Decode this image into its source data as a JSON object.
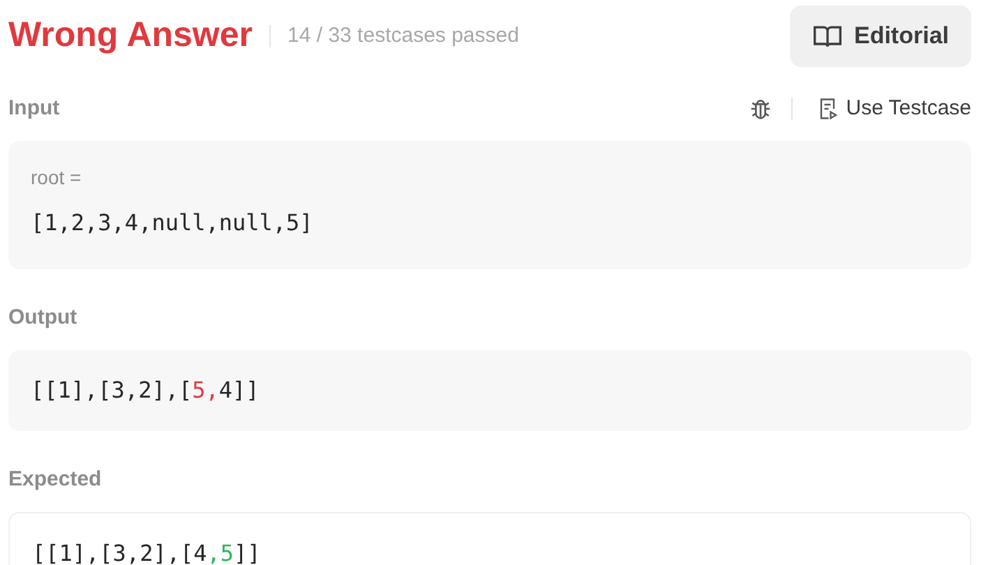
{
  "header": {
    "verdict": "Wrong Answer",
    "summary": "14 / 33 testcases passed",
    "editorial_button": "Editorial"
  },
  "sections": [
    {
      "label": "Input",
      "actions": [
        {
          "kind": "debug"
        },
        {
          "kind": "use_testcase",
          "label": "Use Testcase"
        }
      ],
      "boxed": true,
      "variable": "root =",
      "segments": [
        {
          "kind": "plain",
          "text": "[1,2,3,4,null,null,5]"
        }
      ]
    },
    {
      "label": "Output",
      "boxed": true,
      "segments": [
        {
          "kind": "plain",
          "text": "[[1],[3,2],["
        },
        {
          "kind": "wrong",
          "text": "5,"
        },
        {
          "kind": "plain",
          "text": "4]]"
        }
      ]
    },
    {
      "label": "Expected",
      "boxed": false,
      "segments": [
        {
          "kind": "plain",
          "text": "[[1],[3,2],[4"
        },
        {
          "kind": "right",
          "text": ",5"
        },
        {
          "kind": "plain",
          "text": "]]"
        }
      ]
    }
  ]
}
